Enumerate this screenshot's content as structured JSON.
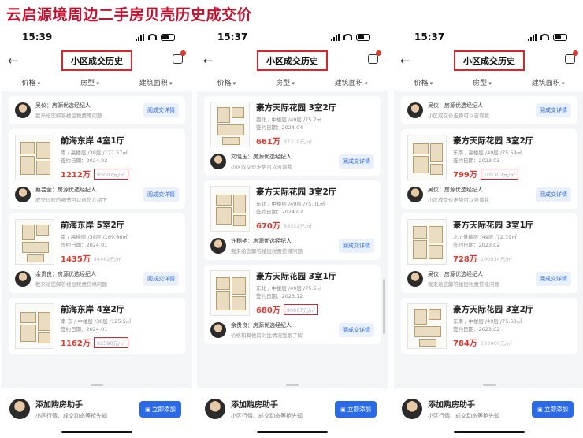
{
  "banner": "云启源境周边二手房贝壳历史成交价",
  "filters": [
    "价格",
    "房型",
    "建筑面积"
  ],
  "nav_title": "小区成交历史",
  "detail_label": "阅成交详情",
  "helper": {
    "title": "添加购房助手",
    "subtitle": "小区行情、成交动态等抢先知",
    "button": "立即添加"
  },
  "icons": [
    "back-arrow-icon",
    "message-icon",
    "signal-icon",
    "wifi-icon",
    "battery-icon"
  ],
  "colors": {
    "price": "#e0382e",
    "highlight_box": "#d9232d",
    "banner": "#c8102e",
    "button": "#2b6ae6"
  },
  "phones": [
    {
      "time": "15:39",
      "top_agent": {
        "name": "吴仪：房源优选经纪人",
        "desc": "我来给您解答楼层税费等问题"
      },
      "listings": [
        {
          "name": "前海东岸 4室1厅",
          "spec": "南 / 高楼层 /38层 /127.57㎡",
          "date": "签约日期：2024.02",
          "price": "1212万",
          "unit": "95007元/㎡",
          "boxed": true,
          "agent": {
            "name": "蔡芸莹：房源优选经纪人",
            "desc": "成交过程的细节可以给您介绍下"
          }
        },
        {
          "name": "前海东岸 5室2厅",
          "spec": "南 / 高楼层 /38层 /169.66㎡",
          "date": "签约日期：2024.01",
          "price": "1435万",
          "unit": "84482元/㎡",
          "boxed": false,
          "agent": {
            "name": "余贵良：房源优选经纪人",
            "desc": "我来给您解答楼层税费贷缘问题"
          }
        },
        {
          "name": "前海东岸 4室2厅",
          "spec": "南 东 / 中楼层 /38层 /125.5㎡",
          "date": "签约日期：2024.01",
          "price": "1162万",
          "unit": "92590元/㎡",
          "boxed": true
        }
      ]
    },
    {
      "time": "15:37",
      "listings": [
        {
          "name": "豪方天际花园 3室2厅",
          "spec": "西北 / 中楼层 /49层 /75.7㎡",
          "date": "签约日期：2024.04",
          "price": "661万",
          "unit": "87319元/㎡",
          "boxed": false,
          "agent": {
            "name": "文晓玉：房源优选经纪人",
            "desc": "小区成交价走势可以咨询我"
          }
        },
        {
          "name": "豪方天际花园 3室2厅",
          "spec": "东北 / 中楼层 /49层 /75.01㎡",
          "date": "签约日期：2024.02",
          "price": "670万",
          "unit": "89322元/㎡",
          "boxed": false,
          "agent": {
            "name": "许穗艳：房源优选经纪人",
            "desc": "我来给您解答楼层税费贷缘问题"
          }
        },
        {
          "name": "豪方天际花园 3室1厅",
          "spec": "东北 / 中楼层 /49层 /75.5㎡",
          "date": "签约日期：2023.12",
          "price": "680万",
          "unit": "90067元/㎡",
          "boxed": true,
          "agent": {
            "name": "余贵良：房源优选经纪人",
            "desc": "价格和其他房对比情况我跟了解"
          }
        }
      ]
    },
    {
      "time": "15:37",
      "top_agent": {
        "name": "吴仪：房源优选经纪人",
        "desc": "小区成交价走势可以咨询我"
      },
      "listings": [
        {
          "name": "豪方天际花园 3室2厅",
          "spec": "东南 / 高楼层 /49层 /75.59㎡",
          "date": "签约日期：2023.03",
          "price": "799万",
          "unit": "105702元/㎡",
          "boxed": true,
          "agent": {
            "name": "吴仪：房源优选经纪人",
            "desc": "小区成交价走势可以咨询我"
          }
        },
        {
          "name": "豪方天际花园 3室1厅",
          "spec": "北 / 低楼层 /49层 /72.79㎡",
          "date": "签约日期：2023.02",
          "price": "728万",
          "unit": "100014元/㎡",
          "boxed": false,
          "agent": {
            "name": "吴仪：房源优选经纪人",
            "desc": "我来给您解答楼层税费贷缘问题"
          }
        },
        {
          "name": "豪方天际花园 3室2厅",
          "spec": "东南 / 中楼层 /49层 /75.53㎡",
          "date": "签约日期：2023.02",
          "price": "784万",
          "unit": "103800元/㎡",
          "boxed": false
        }
      ]
    }
  ]
}
